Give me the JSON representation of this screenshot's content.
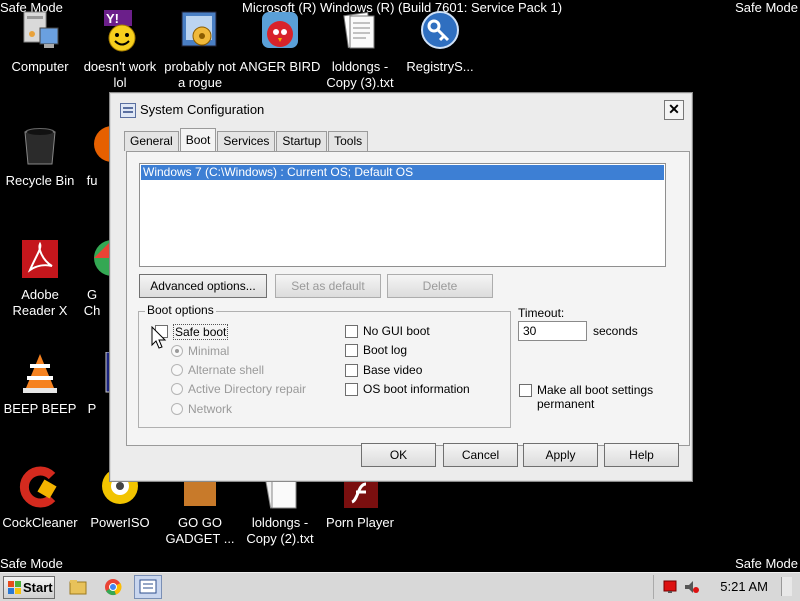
{
  "safe_mode": {
    "tl": "Safe Mode",
    "tr": "Safe Mode",
    "bl": "Safe Mode",
    "br": "Safe Mode"
  },
  "top_banner": "Microsoft (R) Windows (R) (Build 7601: Service Pack 1)",
  "desktop_icons": [
    {
      "label": "Computer",
      "icon": "computer-icon"
    },
    {
      "label": "doesn't work\nlol",
      "icon": "yahoo-messenger-icon"
    },
    {
      "label": "probably not\na rogue",
      "icon": "app-installer-icon"
    },
    {
      "label": "ANGER BIRD",
      "icon": "angry-bird-icon"
    },
    {
      "label": "loldongs -\nCopy (3).txt",
      "icon": "text-file-icon"
    },
    {
      "label": "RegistryS...",
      "icon": "registry-key-icon"
    },
    {
      "label": "Recycle Bin",
      "icon": "recycle-bin-icon"
    },
    {
      "label": "fu",
      "icon": "firefox-icon"
    },
    {
      "label": "Adobe\nReader X",
      "icon": "adobe-reader-icon"
    },
    {
      "label": "G\nCh",
      "icon": "chrome-icon"
    },
    {
      "label": "BEEP BEEP",
      "icon": "vlc-icon"
    },
    {
      "label": "P",
      "icon": "app-icon"
    },
    {
      "label": "CockCleaner",
      "icon": "ccleaner-icon"
    },
    {
      "label": "PowerISO",
      "icon": "poweriso-icon"
    },
    {
      "label": "GO GO\nGADGET ...",
      "icon": "folder-icon"
    },
    {
      "label": "loldongs -\nCopy (2).txt",
      "icon": "text-file-icon"
    },
    {
      "label": "Porn Player",
      "icon": "flash-player-icon"
    }
  ],
  "dialog": {
    "title": "System Configuration",
    "tabs": [
      "General",
      "Boot",
      "Services",
      "Startup",
      "Tools"
    ],
    "active_tab": "Boot",
    "os_list": [
      "Windows 7 (C:\\Windows) : Current OS; Default OS"
    ],
    "buttons": {
      "advanced": "Advanced options...",
      "set_default": "Set as default",
      "delete": "Delete",
      "ok": "OK",
      "cancel": "Cancel",
      "apply": "Apply",
      "help": "Help"
    },
    "boot_options": {
      "title": "Boot options",
      "safe_boot": "Safe boot",
      "radios": [
        "Minimal",
        "Alternate shell",
        "Active Directory repair",
        "Network"
      ],
      "no_gui": "No GUI boot",
      "boot_log": "Boot log",
      "base_video": "Base video",
      "os_boot_info": "OS boot information"
    },
    "timeout": {
      "label": "Timeout:",
      "value": "30",
      "unit": "seconds"
    },
    "permanent": "Make all boot settings\npermanent"
  },
  "taskbar": {
    "start": "Start",
    "clock": "5:21 AM"
  }
}
